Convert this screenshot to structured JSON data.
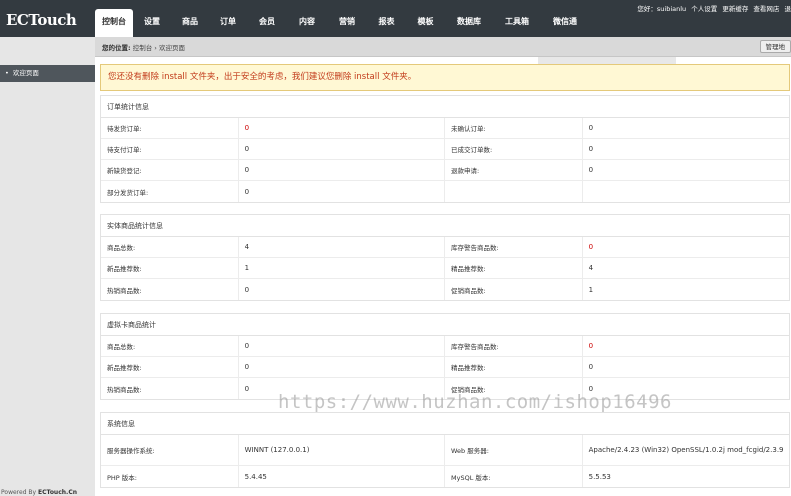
{
  "logo": "ECTouch",
  "nav": [
    {
      "label": "控制台",
      "active": true
    },
    {
      "label": "设置"
    },
    {
      "label": "商品"
    },
    {
      "label": "订单"
    },
    {
      "label": "会员"
    },
    {
      "label": "内容"
    },
    {
      "label": "营销"
    },
    {
      "label": "报表"
    },
    {
      "label": "模板"
    },
    {
      "label": "数据库"
    },
    {
      "label": "工具箱"
    },
    {
      "label": "微信通"
    }
  ],
  "user": {
    "greeting": "您好：suibianlu",
    "profile": "个人设置",
    "refresh": "更新缓存",
    "view_store": "查看网店",
    "logout": "退"
  },
  "breadcrumb": {
    "prefix": "您的位置:",
    "root": "控制台",
    "sep": "›",
    "current": "欢迎页面"
  },
  "manage_button": "管理地",
  "sidebar": {
    "items": [
      "欢迎页面"
    ],
    "powered_label": "Powered By",
    "powered_brand": "ECTouch.Cn"
  },
  "warning": "您还没有删除 install 文件夹，出于安全的考虑，我们建议您删除 install 文件夹。",
  "sections": {
    "orders": {
      "title": "订单统计信息",
      "rows": [
        [
          "待发货订单:",
          "0",
          "未确认订单:",
          "0"
        ],
        [
          "待支付订单:",
          "0",
          "已成交订单数:",
          "0"
        ],
        [
          "新缺货登记:",
          "0",
          "退款申请:",
          "0"
        ],
        [
          "部分发货订单:",
          "0",
          "",
          ""
        ]
      ]
    },
    "goods": {
      "title": "实体商品统计信息",
      "rows": [
        [
          "商品总数:",
          "4",
          "库存警告商品数:",
          "0"
        ],
        [
          "新品推荐数:",
          "1",
          "精品推荐数:",
          "4"
        ],
        [
          "热销商品数:",
          "0",
          "促销商品数:",
          "1"
        ]
      ]
    },
    "virtual": {
      "title": "虚拟卡商品统计",
      "rows": [
        [
          "商品总数:",
          "0",
          "库存警告商品数:",
          "0"
        ],
        [
          "新品推荐数:",
          "0",
          "精品推荐数:",
          "0"
        ],
        [
          "热销商品数:",
          "0",
          "促销商品数:",
          "0"
        ]
      ]
    },
    "system": {
      "title": "系统信息",
      "rows": [
        [
          "服务器操作系统:",
          "WINNT (127.0.0.1)",
          "Web 服务器:",
          "Apache/2.4.23 (Win32) OpenSSL/1.0.2j mod_fcgid/2.3.9"
        ],
        [
          "PHP 版本:",
          "5.4.45",
          "MySQL 版本:",
          "5.5.53"
        ]
      ]
    }
  },
  "watermark": "https://www.huzhan.com/ishop16496",
  "colors": {
    "topbar": "#333a40",
    "warning_bg": "#fff8d4",
    "warning_text": "#c23a1a",
    "alert_value": "#cc0000"
  }
}
